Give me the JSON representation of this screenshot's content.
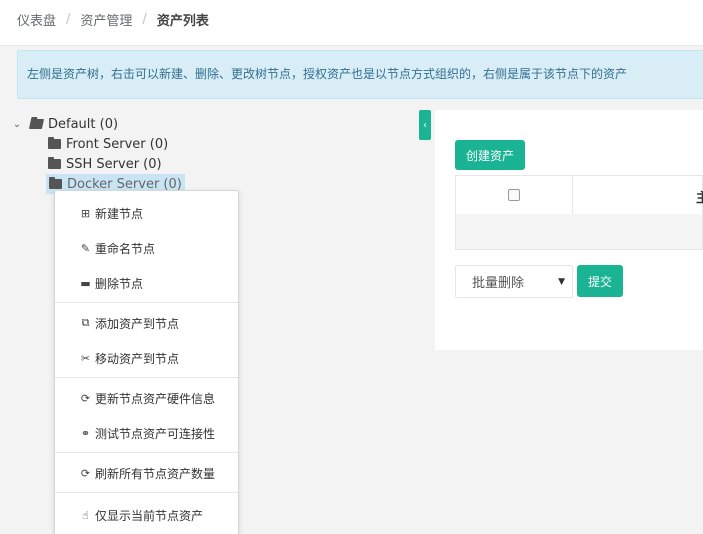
{
  "breadcrumb": {
    "items": [
      "仪表盘",
      "资产管理",
      "资产列表"
    ],
    "separator": "/"
  },
  "alert": {
    "text": "左侧是资产树，右击可以新建、删除、更改树节点，授权资产也是以节点方式组织的，右侧是属于该节点下的资产"
  },
  "tree": {
    "root": {
      "label": "Default (0)",
      "expanded": true,
      "icon": "folder-open-icon"
    },
    "children": [
      {
        "label": "Front Server (0)",
        "icon": "folder-icon"
      },
      {
        "label": "SSH Server (0)",
        "icon": "folder-icon"
      },
      {
        "label": "Docker Server (0)",
        "icon": "folder-icon",
        "selected": true
      }
    ]
  },
  "toolbar": {
    "collapse_icon": "chevron-left-icon",
    "create_label": "创建资产"
  },
  "table": {
    "header_partial": "主"
  },
  "bulk": {
    "selected": "批量删除",
    "submit_label": "提交"
  },
  "context_menu": {
    "items": [
      {
        "icon": "plus-square-icon",
        "glyph": "⊞",
        "label": "新建节点"
      },
      {
        "icon": "edit-icon",
        "glyph": "✎",
        "label": "重命名节点"
      },
      {
        "icon": "minus-square-icon",
        "glyph": "▬",
        "label": "删除节点"
      },
      {
        "icon": "copy-icon",
        "glyph": "⧉",
        "label": "添加资产到节点"
      },
      {
        "icon": "scissors-icon",
        "glyph": "✂",
        "label": "移动资产到节点"
      },
      {
        "icon": "refresh-icon",
        "glyph": "⟳",
        "label": "更新节点资产硬件信息"
      },
      {
        "icon": "link-icon",
        "glyph": "⚭",
        "label": "测试节点资产可连接性"
      },
      {
        "icon": "refresh-icon",
        "glyph": "⟳",
        "label": "刷新所有节点资产数量"
      },
      {
        "icon": "hand-pointer-icon",
        "glyph": "☝",
        "label": "仅显示当前节点资产"
      }
    ]
  },
  "colors": {
    "primary": "#1ab394",
    "alert_bg": "#d9edf7",
    "alert_text": "#31708f",
    "selected_node": "#c9e5f5"
  }
}
